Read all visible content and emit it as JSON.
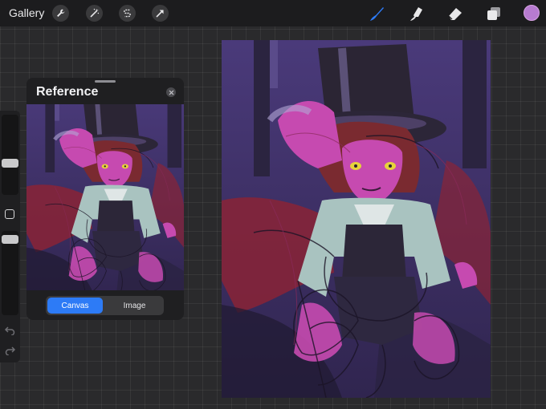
{
  "topbar": {
    "gallery_label": "Gallery",
    "tools_left": [
      "wrench-icon",
      "magic-wand-icon",
      "selection-icon",
      "transform-arrow-icon"
    ],
    "tools_right": [
      "brush-icon",
      "smudge-icon",
      "eraser-icon",
      "layers-icon"
    ],
    "active_tool": "brush-icon",
    "current_color": "#b77bd0",
    "accent_color": "#2d7bf6"
  },
  "sidebar": {
    "brush_size_level": 0.5,
    "opacity_level": 0.5,
    "icons": [
      "modify-square-icon",
      "undo-icon",
      "redo-icon"
    ]
  },
  "reference": {
    "title": "Reference",
    "tabs": [
      {
        "label": "Canvas",
        "active": true
      },
      {
        "label": "Image",
        "active": false
      }
    ]
  },
  "canvas": {
    "palette": [
      "#3a2d63",
      "#6a55a8",
      "#c64ab0",
      "#8a2336",
      "#a9c3c0",
      "#2c1f3a",
      "#e6d33a"
    ]
  }
}
